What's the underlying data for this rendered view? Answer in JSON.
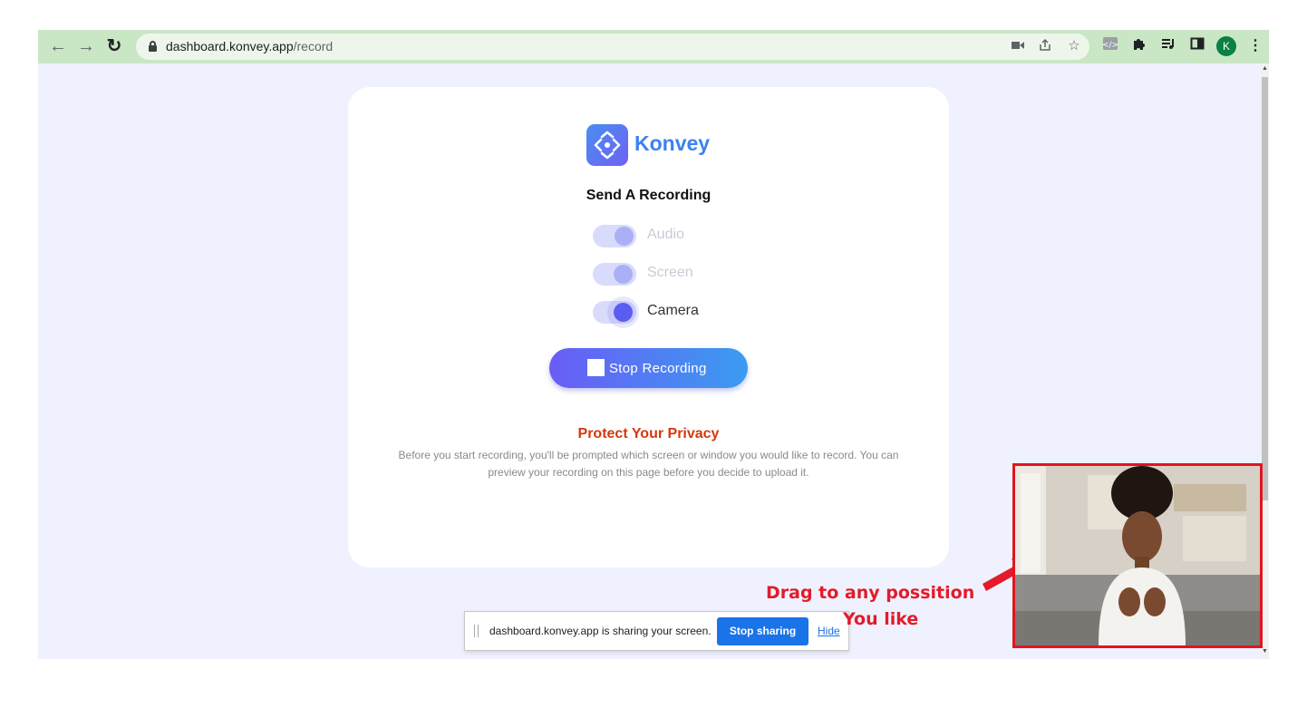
{
  "browser": {
    "url_host": "dashboard.konvey.app",
    "url_path": "/record",
    "avatar_letter": "K"
  },
  "page": {
    "brand": "Konvey",
    "heading": "Send A Recording",
    "toggles": [
      {
        "label": "Audio",
        "on": false
      },
      {
        "label": "Screen",
        "on": false
      },
      {
        "label": "Camera",
        "on": true
      }
    ],
    "stop_button": "Stop Recording",
    "privacy_title": "Protect Your Privacy",
    "privacy_text": "Before you start recording, you'll be prompted which screen or window you would like to record. You can preview your recording on this page before you decide to upload it."
  },
  "share_bar": {
    "message": "dashboard.konvey.app is sharing your screen.",
    "stop_label": "Stop sharing",
    "hide_label": "Hide"
  },
  "annotation": {
    "line1": "Drag to any possition",
    "line2": "You like",
    "color": "#e31b2a"
  },
  "colors": {
    "toolbar": "#c9e6c5",
    "page_bg": "#eff2fe",
    "brand": "#3d82f0",
    "button_start": "#6a5cf6",
    "button_end": "#3a9cf1",
    "privacy_title": "#d4380d",
    "share_button": "#1a73e8"
  }
}
